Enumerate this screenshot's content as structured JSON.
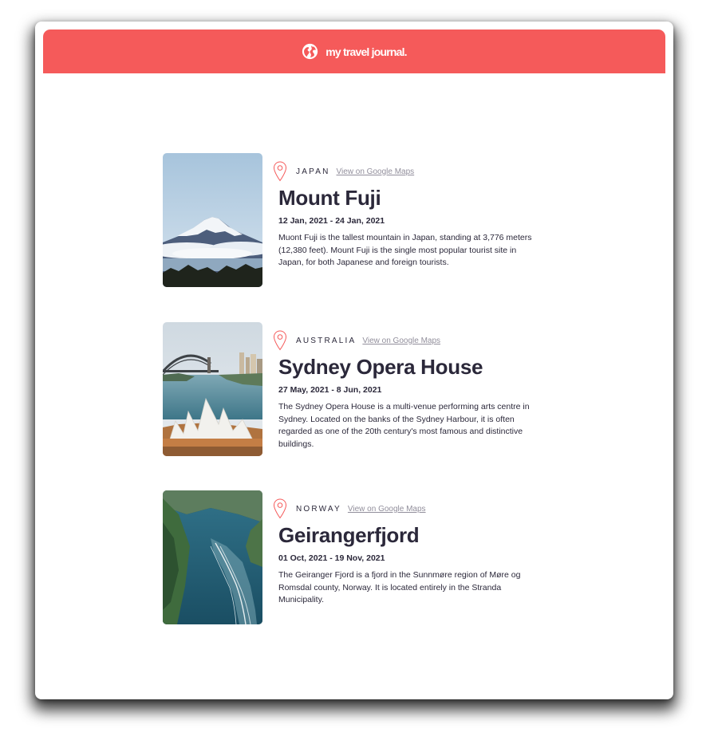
{
  "header": {
    "title": "my travel journal.",
    "icon": "globe-icon",
    "background_color": "#F55A5A"
  },
  "entries": [
    {
      "country": "JAPAN",
      "maps_label": "View on Google Maps",
      "title": "Mount Fuji",
      "dates": "12 Jan, 2021 - 24 Jan, 2021",
      "description": "Muont Fuji is the tallest mountain in Japan, standing at 3,776 meters (12,380 feet). Mount Fuji is the single most popular tourist site in Japan, for both Japanese and foreign tourists."
    },
    {
      "country": "AUSTRALIA",
      "maps_label": "View on Google Maps",
      "title": "Sydney Opera House",
      "dates": "27 May, 2021 - 8 Jun, 2021",
      "description": "The Sydney Opera House is a multi-venue performing arts centre in Sydney. Located on the banks of the Sydney Harbour, it is often regarded as one of the 20th century's most famous and distinctive buildings."
    },
    {
      "country": "NORWAY",
      "maps_label": "View on Google Maps",
      "title": "Geirangerfjord",
      "dates": "01 Oct, 2021 - 19 Nov, 2021",
      "description": "The Geiranger Fjord is a fjord in the Sunnmøre region of Møre og Romsdal county, Norway. It is located entirely in the Stranda Municipality."
    }
  ],
  "colors": {
    "accent": "#F55A5A",
    "text": "#2B283A",
    "muted": "#918E9B"
  }
}
